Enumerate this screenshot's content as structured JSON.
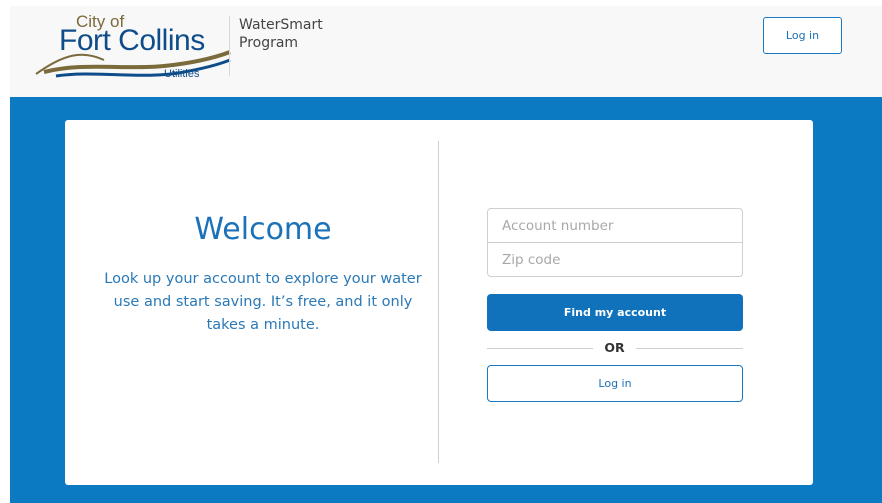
{
  "header": {
    "logo": {
      "city_of": "City of",
      "name": "Fort Collins",
      "sub": "Utilities"
    },
    "program_name": "WaterSmart Program",
    "login_label": "Log in"
  },
  "welcome": {
    "title": "Welcome",
    "description": "Look up your account to explore your water use and start saving. It’s free, and it only takes a minute."
  },
  "form": {
    "account_placeholder": "Account number",
    "zip_placeholder": "Zip code",
    "find_label": "Find my account",
    "or_label": "OR",
    "login_label": "Log in"
  },
  "colors": {
    "brand_blue": "#0b7ac3",
    "button_blue": "#1172bc",
    "logo_navy": "#0f4c8a",
    "logo_brown": "#7a6a3c"
  }
}
